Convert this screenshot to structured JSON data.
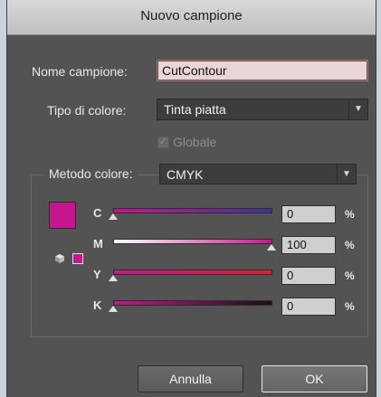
{
  "window": {
    "title": "Nuovo campione"
  },
  "swatch_name": {
    "label": "Nome campione:",
    "value": "CutContour"
  },
  "color_type": {
    "label": "Tipo di colore:",
    "value": "Tinta piatta"
  },
  "global": {
    "label": "Globale",
    "checked": true,
    "enabled": false
  },
  "color_mode": {
    "label": "Metodo colore:",
    "value": "CMYK"
  },
  "swatch_color": "#c61690",
  "channels": [
    {
      "name": "C",
      "value": "0",
      "unit": "%"
    },
    {
      "name": "M",
      "value": "100",
      "unit": "%"
    },
    {
      "name": "Y",
      "value": "0",
      "unit": "%"
    },
    {
      "name": "K",
      "value": "0",
      "unit": "%"
    }
  ],
  "buttons": {
    "cancel": "Annulla",
    "ok": "OK"
  },
  "icons": {
    "dropdown": "chevron-down-icon",
    "checkbox": "check-icon",
    "gamut": "cube-icon"
  }
}
